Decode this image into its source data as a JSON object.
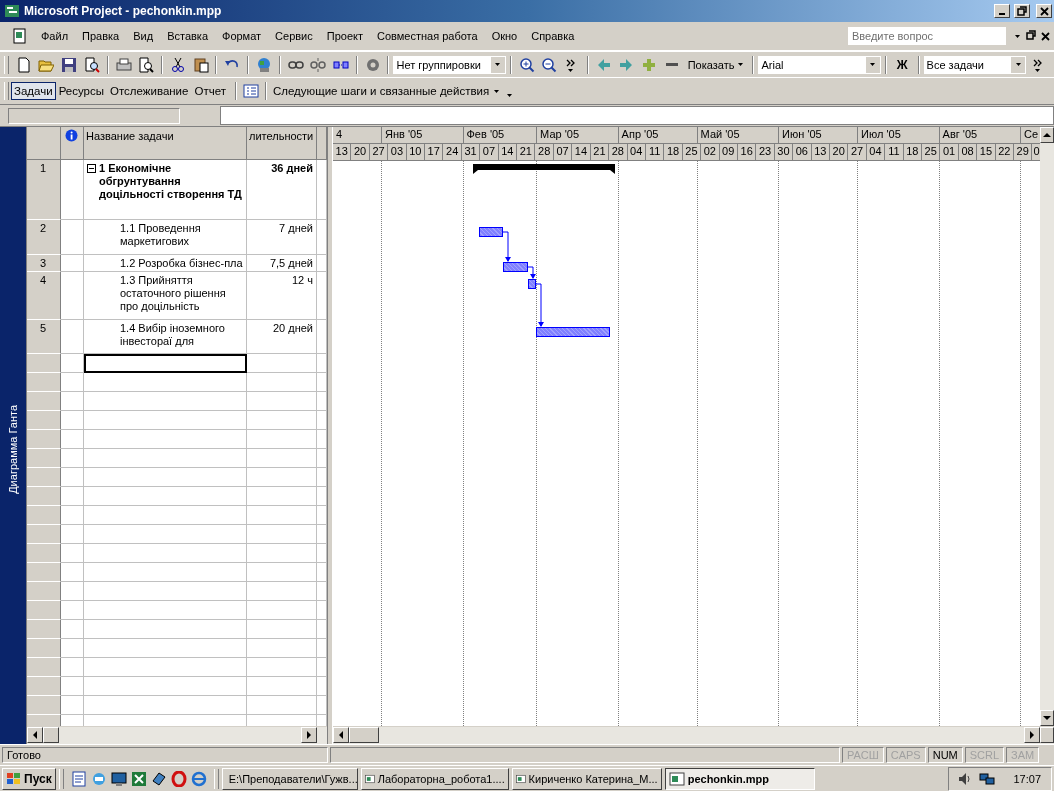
{
  "window": {
    "title": "Microsoft Project - pechonkin.mpp"
  },
  "menu_bar": {
    "items": [
      "Файл",
      "Правка",
      "Вид",
      "Вставка",
      "Формат",
      "Сервис",
      "Проект",
      "Совместная работа",
      "Окно",
      "Справка"
    ],
    "help": {
      "placeholder": "Введите вопрос"
    }
  },
  "toolbar": {
    "grouping": "Нет группировки",
    "show_button": "Показать",
    "font": "Arial",
    "bold_button": "Ж",
    "filter": "Все задачи"
  },
  "guide_bar": {
    "tabs": [
      {
        "label": "Задачи",
        "selected": true
      },
      {
        "label": "Ресурсы",
        "selected": false
      },
      {
        "label": "Отслеживание",
        "selected": false
      },
      {
        "label": "Отчет",
        "selected": false
      }
    ],
    "actions_menu": "Следующие шаги и связанные действия"
  },
  "view_bar": {
    "label": "Диаграмма Ганта"
  },
  "table": {
    "columns": [
      "Название задачи",
      "лительности"
    ],
    "rows": [
      {
        "id": "1",
        "name": "1 Економічне обгрунтування доцільності створення ТД",
        "duration": "36 дней",
        "expanded": true,
        "children": [
          {
            "id": "2",
            "name": "1.1 Проведення маркетигових",
            "duration": "7 дней"
          },
          {
            "id": "3",
            "name": "1.2 Розробка бізнес-пла",
            "duration": "7,5 дней"
          },
          {
            "id": "4",
            "name": "1.3 Прийняття остаточного рішення про доцільність",
            "duration": "12 ч"
          },
          {
            "id": "5",
            "name": "1.4 Вибір іноземного інвестораї для",
            "duration": "20 дней"
          }
        ]
      }
    ],
    "new_row": {
      "selected": true
    }
  },
  "timescale": {
    "months": [
      "4",
      "Янв '05",
      "Фев '05",
      "Мар '05",
      "Апр '05",
      "Май '05",
      "Июн '05",
      "Июл '05",
      "Авг '05",
      "Се"
    ],
    "weeks": [
      "13",
      "20",
      "27",
      "03",
      "10",
      "17",
      "24",
      "31",
      "07",
      "14",
      "21",
      "28",
      "07",
      "14",
      "21",
      "28",
      "04",
      "11",
      "18",
      "25",
      "02",
      "09",
      "16",
      "23",
      "30",
      "06",
      "13",
      "20",
      "27",
      "04",
      "11",
      "18",
      "25",
      "01",
      "08",
      "15",
      "22",
      "29",
      "0"
    ]
  },
  "status_bar": {
    "text": "Готово",
    "indicators": [
      {
        "label": "РАСШ",
        "on": false
      },
      {
        "label": "CAPS",
        "on": false
      },
      {
        "label": "NUM",
        "on": true
      },
      {
        "label": "SCRL",
        "on": false
      },
      {
        "label": "ЗАМ",
        "on": false
      }
    ]
  },
  "taskbar": {
    "start": "Пуск",
    "tasks": [
      {
        "label": "E:\\Преподаватели\\Гужв...",
        "selected": false
      },
      {
        "label": "Лабораторна_робота1....",
        "selected": false
      },
      {
        "label": "Кириченко Катерина_М...",
        "selected": false
      },
      {
        "label": "pechonkin.mpp",
        "selected": true
      }
    ],
    "clock": "17:07"
  }
}
